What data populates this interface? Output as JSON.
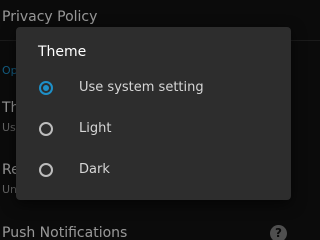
{
  "background": {
    "privacy_title": "Privacy Policy",
    "section_label": "Op",
    "theme_title": "Th",
    "theme_sub": "Us",
    "reset_title": "Re",
    "reset_sub": "Un",
    "push_title": "Push Notifications",
    "help_glyph": "?"
  },
  "dialog": {
    "title": "Theme",
    "options": [
      {
        "label": "Use system setting",
        "checked": true
      },
      {
        "label": "Light",
        "checked": false
      },
      {
        "label": "Dark",
        "checked": false
      }
    ]
  },
  "colors": {
    "accent": "#1e90c8",
    "dialog_bg": "#2d2d2d",
    "screen_bg": "#121212"
  }
}
